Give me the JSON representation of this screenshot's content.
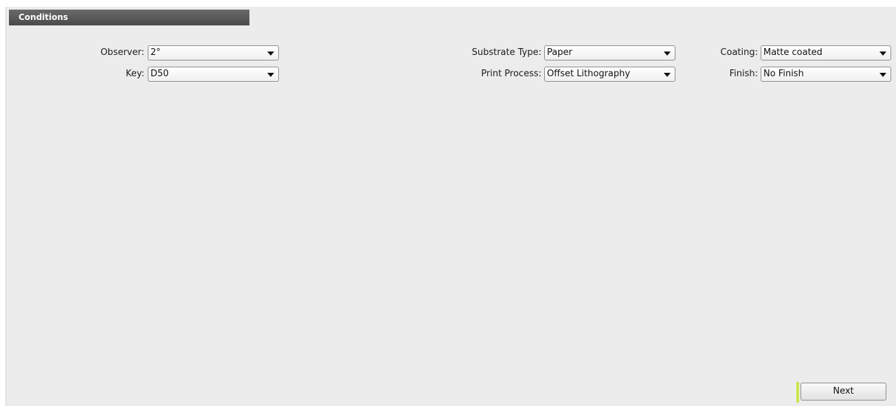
{
  "section": {
    "title": "Conditions"
  },
  "fields": {
    "observer": {
      "label": "Observer:",
      "value": "2°"
    },
    "key": {
      "label": "Key:",
      "value": "D50"
    },
    "substrate_type": {
      "label": "Substrate Type:",
      "value": "Paper"
    },
    "print_process": {
      "label": "Print Process:",
      "value": "Offset Lithography"
    },
    "coating": {
      "label": "Coating:",
      "value": "Matte coated"
    },
    "finish": {
      "label": "Finish:",
      "value": "No Finish"
    }
  },
  "actions": {
    "next_label": "Next"
  },
  "colors": {
    "header_bg": "#555555",
    "panel_bg": "#ececec",
    "next_accent": "#c8e64a"
  }
}
